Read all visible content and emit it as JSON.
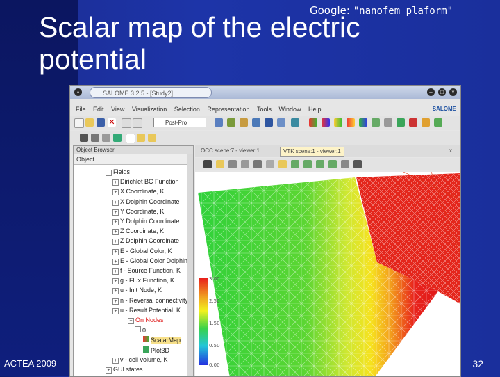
{
  "slide": {
    "title_line1": "Scalar map of the electric",
    "title_line2": "potential",
    "google_prefix": "Google:",
    "google_query": "\"nanofem plaform\"",
    "footer_left": "ACTEA 2009",
    "page_number": "32"
  },
  "window": {
    "title": "SALOME 3.2.5 - [Study2]",
    "menu": [
      "File",
      "Edit",
      "View",
      "Visualization",
      "Selection",
      "Representation",
      "Tools",
      "Window",
      "Help"
    ],
    "brand": "SALOME",
    "module_combo": "Post-Pro"
  },
  "object_browser": {
    "header": "Object Browser",
    "column": "Object",
    "items": [
      {
        "label": "Fields",
        "level": 0
      },
      {
        "label": "Dirichlet BC Function",
        "level": 1
      },
      {
        "label": "X Coordinate, K",
        "level": 1
      },
      {
        "label": "X Dolphin Coordinate",
        "level": 1
      },
      {
        "label": "Y Coordinate, K",
        "level": 1
      },
      {
        "label": "Y Dolphin Coordinate",
        "level": 1
      },
      {
        "label": "Z Coordinate, K",
        "level": 1
      },
      {
        "label": "Z Dolphin Coordinate",
        "level": 1
      },
      {
        "label": "E - Global Color, K",
        "level": 1
      },
      {
        "label": "E - Global Color Dolphin",
        "level": 1
      },
      {
        "label": "f - Source Function, K",
        "level": 1
      },
      {
        "label": "g - Flux Function, K",
        "level": 1
      },
      {
        "label": "u - Init Node, K",
        "level": 1
      },
      {
        "label": "n - Reversal connectivity",
        "level": 1
      },
      {
        "label": "u - Result Potential, K",
        "level": 1
      },
      {
        "label": "On Nodes",
        "level": 2
      },
      {
        "label": "0,",
        "level": 3
      },
      {
        "label": "ScalarMap",
        "level": 4
      },
      {
        "label": "Plot3D",
        "level": 4
      },
      {
        "label": "v - cell volume, K",
        "level": 1
      },
      {
        "label": "GUI states",
        "level": 0
      }
    ]
  },
  "viewer": {
    "tabs": [
      "OCC scene:7 - viewer:1",
      "VTK scene:1 - viewer:1"
    ],
    "scale_labels": [
      "3.00",
      "2.50",
      "1.50",
      "0.50",
      "0.00"
    ]
  },
  "colors": {
    "slide_bg": "#1d34a8",
    "scalar_high": "#e81b1b",
    "scalar_mid": "#f2f21e",
    "scalar_low": "#3ad24a"
  }
}
